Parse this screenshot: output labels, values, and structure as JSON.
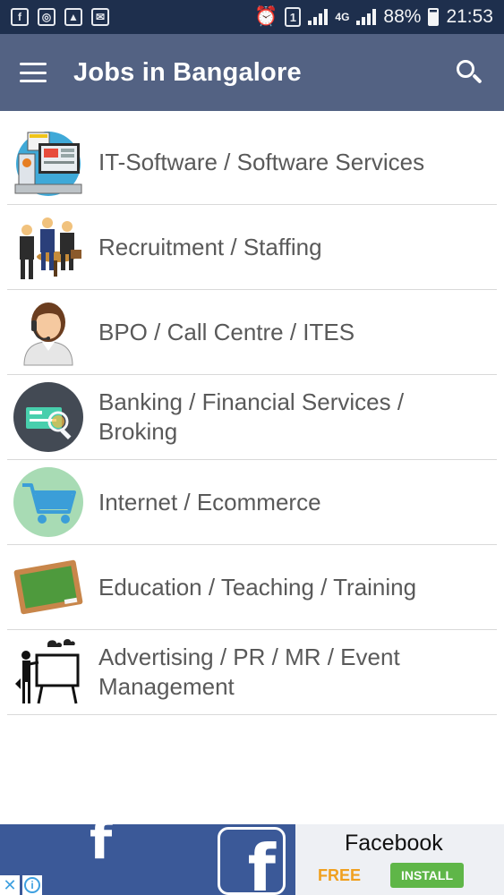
{
  "status_bar": {
    "left_icons": [
      "facebook-icon",
      "instagram-icon",
      "gallery-icon",
      "mail-icon"
    ],
    "sim_slot": "1",
    "network": "4G",
    "battery": "88%",
    "time": "21:53"
  },
  "app_bar": {
    "title": "Jobs in Bangalore",
    "menu_icon": "hamburger-menu-icon",
    "search_icon": "search-icon"
  },
  "categories": [
    {
      "label": "IT-Software / Software Services",
      "icon": "computer-code-icon"
    },
    {
      "label": "Recruitment / Staffing",
      "icon": "business-people-icon"
    },
    {
      "label": "BPO / Call Centre / ITES",
      "icon": "headset-agent-icon"
    },
    {
      "label": "Banking / Financial Services / Broking",
      "icon": "credit-card-magnifier-icon"
    },
    {
      "label": "Internet / Ecommerce",
      "icon": "shopping-cart-icon"
    },
    {
      "label": "Education / Teaching / Training",
      "icon": "chalkboard-icon"
    },
    {
      "label": "Advertising / PR / MR / Event Management",
      "icon": "presentation-board-icon"
    }
  ],
  "ad": {
    "app_name": "Facebook",
    "price": "FREE",
    "cta": "INSTALL",
    "brand_color": "#3b5998",
    "cta_color": "#5fb648"
  },
  "colors": {
    "status_bar": "#1e2f4d",
    "app_bar": "#536283",
    "list_text": "#595959",
    "divider": "#d9d9d9"
  }
}
